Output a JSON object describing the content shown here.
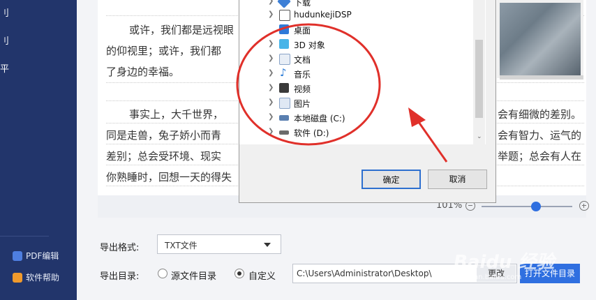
{
  "sidebar": {
    "items": [
      {
        "label": "刂"
      },
      {
        "label": "刂"
      },
      {
        "label": "平"
      }
    ],
    "footer": [
      {
        "label": "PDF编辑"
      },
      {
        "label": "软件帮助"
      }
    ]
  },
  "document": {
    "lines": [
      "或许，我们都是远视眼",
      "的仰视里；或许，我们都",
      "了身边的幸福。",
      "事实上，大千世界，",
      "会有细微的差别。",
      "同是走兽，兔子娇小而青",
      "会有智力、运气的",
      "差别；总会受环境、现实",
      "举题；总会有人在",
      "你熟睡时，回想一天的得失"
    ]
  },
  "zoom": {
    "level": "101%"
  },
  "export": {
    "format_label": "导出格式:",
    "format_value": "TXT文件",
    "dir_label": "导出目录:",
    "radio_source": "源文件目录",
    "radio_custom": "自定义",
    "path_value": "C:\\Users\\Administrator\\Desktop\\",
    "change_btn": "更改",
    "open_btn": "打开文件目录"
  },
  "dialog": {
    "tree": [
      {
        "label": "下载",
        "icon": "download-icon",
        "color": "#3d7fd6"
      },
      {
        "label": "hudunkejiDSP",
        "icon": "app-icon",
        "color": "#555555"
      },
      {
        "label": "桌面",
        "icon": "desktop-icon",
        "color": "#2f7ad8"
      },
      {
        "label": "3D 对象",
        "icon": "cube-icon",
        "color": "#47b4e8"
      },
      {
        "label": "文档",
        "icon": "document-icon",
        "color": "#8aa4c8"
      },
      {
        "label": "音乐",
        "icon": "music-icon",
        "color": "#2a7bd6"
      },
      {
        "label": "视频",
        "icon": "video-icon",
        "color": "#3a3a3a"
      },
      {
        "label": "图片",
        "icon": "picture-icon",
        "color": "#8aa4c8"
      },
      {
        "label": "本地磁盘 (C:)",
        "icon": "disk-icon",
        "color": "#5a7fb0"
      },
      {
        "label": "软件 (D:)",
        "icon": "disk-icon",
        "color": "#6b6b6b"
      }
    ],
    "ok_btn": "确定",
    "cancel_btn": "取消"
  },
  "watermark": {
    "brand": "Baidu 经验",
    "url": "jingyan.baidu.com"
  },
  "colors": {
    "sidebar": "#22356b",
    "accent": "#2f6fe0",
    "annotation": "#e0302a"
  }
}
